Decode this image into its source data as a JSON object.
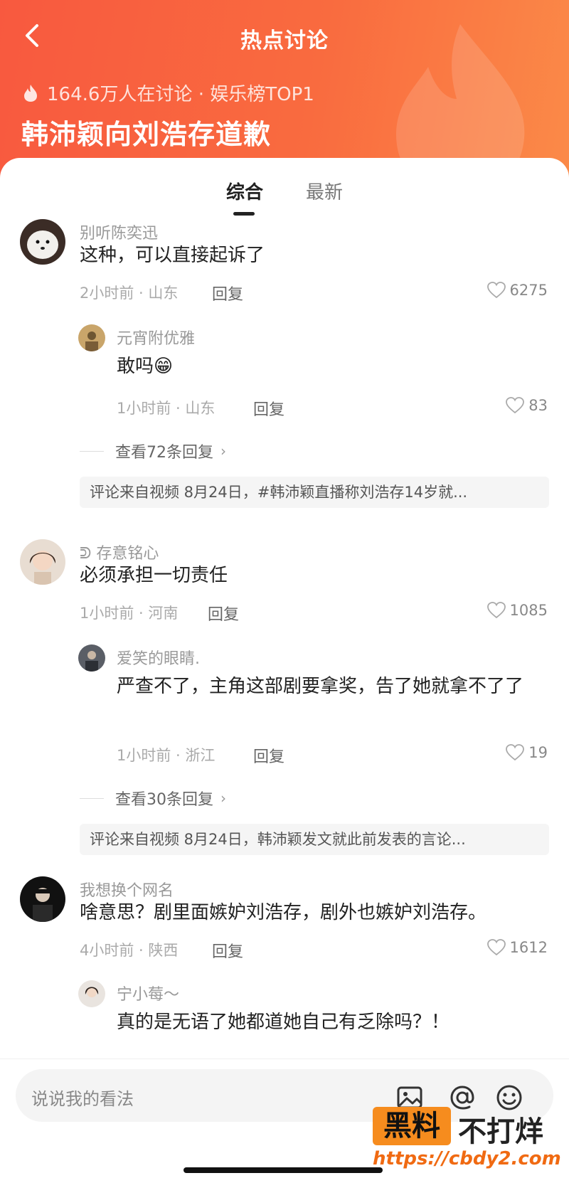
{
  "header": {
    "title": "热点讨论",
    "meta": "164.6万人在讨论 · 娱乐榜TOP1",
    "topic": "韩沛颖向刘浩存道歉"
  },
  "tabs": [
    "综合",
    "最新"
  ],
  "comments": [
    {
      "user": "别听陈奕迅",
      "text": "这种，可以直接起诉了",
      "meta": "2小时前 · 山东",
      "reply_label": "回复",
      "likes": "6275",
      "reply": {
        "user": "元宵附优雅",
        "text": "敢吗😁",
        "meta": "1小时前 · 山东",
        "reply_label": "回复",
        "likes": "83"
      },
      "view_replies": "查看72条回复",
      "source": "评论来自视频 8月24日，#韩沛颖直播称刘浩存14岁就..."
    },
    {
      "user": "ᕲ 存意铭心",
      "text": "必须承担一切责任",
      "meta": "1小时前 · 河南",
      "reply_label": "回复",
      "likes": "1085",
      "reply": {
        "user": "爱笑的眼睛.",
        "text": "严查不了，主角这部剧要拿奖，告了她就拿不了了",
        "meta": "1小时前 · 浙江",
        "reply_label": "回复",
        "likes": "19"
      },
      "view_replies": "查看30条回复",
      "source": "评论来自视频 8月24日，韩沛颖发文就此前发表的言论..."
    },
    {
      "user": "我想换个网名",
      "text": "啥意思？剧里面嫉妒刘浩存，剧外也嫉妒刘浩存。",
      "meta": "4小时前 · 陕西",
      "reply_label": "回复",
      "likes": "1612",
      "reply": {
        "user": "宁小莓～",
        "text": "真的是无语了她都道她自己有乏除吗？！"
      }
    }
  ],
  "input": {
    "placeholder": "说说我的看法"
  },
  "watermark": {
    "badge": "黑料",
    "text": "不打烊",
    "url": "https://cbdy2.com"
  },
  "colors": {
    "header": "#f8593f",
    "accent": "#f68c1e"
  }
}
